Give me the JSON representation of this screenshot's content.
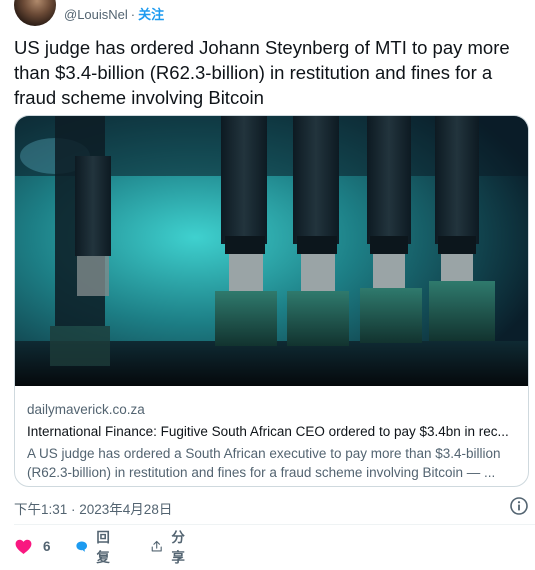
{
  "header": {
    "handle": "@LouisNel",
    "separator": "·",
    "follow_label": "关注"
  },
  "tweet": {
    "text": "US judge has ordered Johann Steynberg of MTI to pay more than $3.4-billion (R62.3-billion) in restitution and fines for a fraud scheme involving Bitcoin"
  },
  "card": {
    "image_icon": "usb-mining-rig-photo",
    "domain": "dailymaverick.co.za",
    "title": "International Finance: Fugitive South African CEO ordered to pay $3.4bn in rec...",
    "description": "A US judge has ordered a South African executive to pay more than $3.4-billion (R62.3-billion) in restitution and fines for a fraud scheme involving Bitcoin — ..."
  },
  "timestamp": "下午1:31 · 2023年4月28日",
  "actions": {
    "like_count": "6",
    "reply_label": "回复",
    "share_label": "分享"
  },
  "colors": {
    "accent": "#1d9bf0",
    "like": "#f91880",
    "muted": "#536471"
  }
}
